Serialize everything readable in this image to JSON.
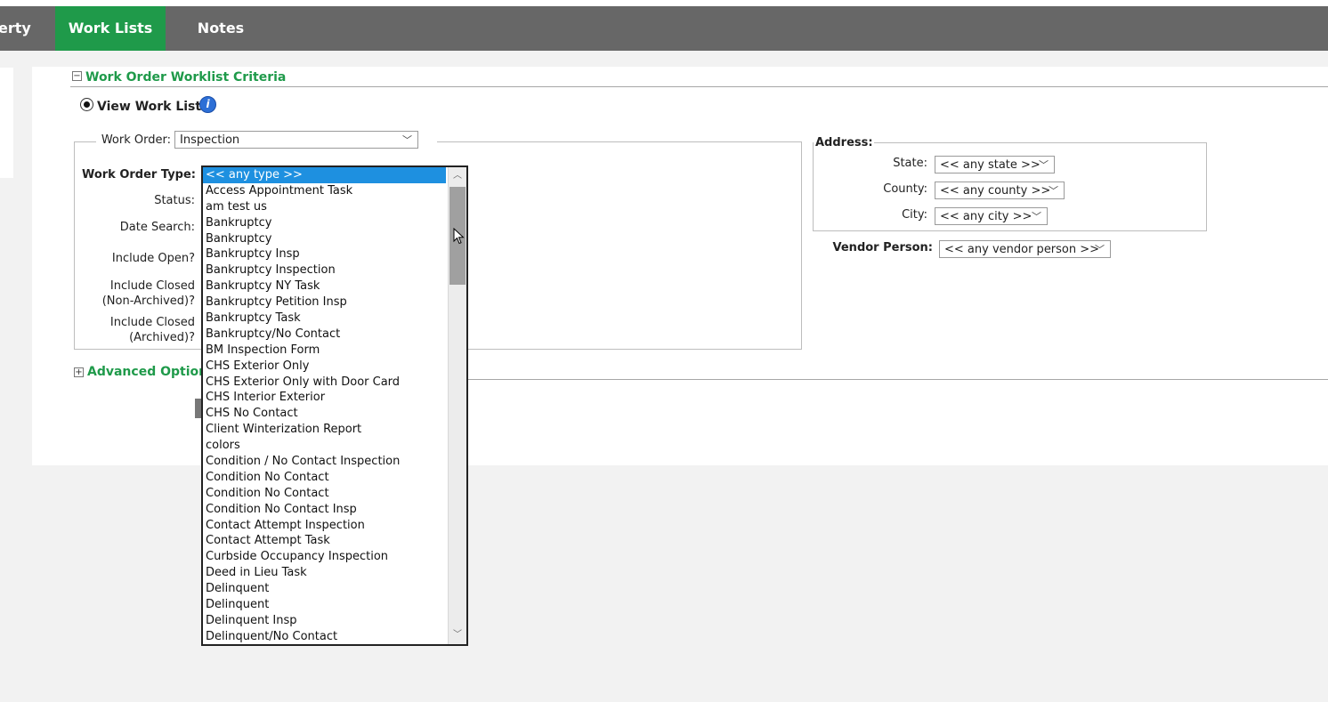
{
  "nav": {
    "tabs": [
      {
        "label": "erty",
        "active": false
      },
      {
        "label": "Work Lists",
        "active": true
      },
      {
        "label": "Notes",
        "active": false
      }
    ]
  },
  "criteria": {
    "title": "Work Order Worklist Criteria",
    "toggle": "−",
    "view_work_lists": "View Work Lists",
    "info": "i",
    "work_order_label": "Work Order:",
    "work_order_value": "Inspection",
    "work_order_type_label": "Work Order Type:",
    "status_label": "Status:",
    "date_search_label": "Date Search:",
    "include_open_label": "Include Open?",
    "include_closed_na_1": "Include Closed",
    "include_closed_na_2": "(Non-Archived)?",
    "include_closed_a_1": "Include Closed",
    "include_closed_a_2": "(Archived)?"
  },
  "address": {
    "title": "Address:",
    "state_label": "State:",
    "state_value": "<< any state >>",
    "county_label": "County:",
    "county_value": "<< any county >>",
    "city_label": "City:",
    "city_value": "<< any city >>",
    "vendor_label": "Vendor Person:",
    "vendor_value": "<< any vendor person >>"
  },
  "advanced": {
    "toggle": "+",
    "title": "Advanced Options"
  },
  "icons": {
    "chevron": "﹀",
    "arrow_up": "︿",
    "arrow_down": "﹀"
  },
  "colors": {
    "accent_green": "#1f9a4a",
    "nav_bg": "#676767",
    "selected_option": "#1e90e0"
  },
  "work_order_type_options": [
    {
      "label": "<< any type >>",
      "selected": true
    },
    {
      "label": "Access Appointment Task"
    },
    {
      "label": "am test us"
    },
    {
      "label": "Bankruptcy"
    },
    {
      "label": "Bankruptcy"
    },
    {
      "label": "Bankruptcy Insp"
    },
    {
      "label": "Bankruptcy Inspection"
    },
    {
      "label": "Bankruptcy NY Task"
    },
    {
      "label": "Bankruptcy Petition Insp"
    },
    {
      "label": "Bankruptcy Task"
    },
    {
      "label": "Bankruptcy/No Contact"
    },
    {
      "label": "BM Inspection Form"
    },
    {
      "label": "CHS Exterior Only"
    },
    {
      "label": "CHS Exterior Only with Door Card"
    },
    {
      "label": "CHS Interior Exterior"
    },
    {
      "label": "CHS No Contact"
    },
    {
      "label": "Client Winterization Report"
    },
    {
      "label": "colors"
    },
    {
      "label": "Condition / No Contact Inspection"
    },
    {
      "label": "Condition No Contact"
    },
    {
      "label": "Condition No Contact"
    },
    {
      "label": "Condition No Contact Insp"
    },
    {
      "label": "Contact Attempt Inspection"
    },
    {
      "label": "Contact Attempt Task"
    },
    {
      "label": "Curbside Occupancy Inspection"
    },
    {
      "label": "Deed in Lieu Task"
    },
    {
      "label": "Delinquent"
    },
    {
      "label": "Delinquent"
    },
    {
      "label": "Delinquent Insp"
    },
    {
      "label": "Delinquent/No Contact"
    }
  ]
}
